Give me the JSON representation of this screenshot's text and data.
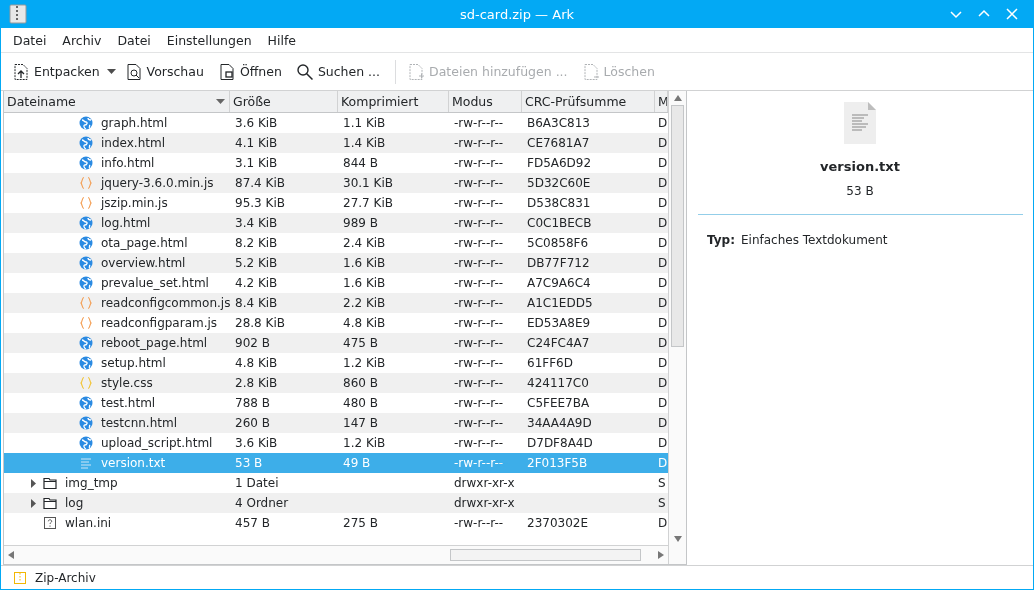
{
  "window": {
    "title": "sd-card.zip — Ark"
  },
  "menu": [
    "Datei",
    "Archiv",
    "Datei",
    "Einstellungen",
    "Hilfe"
  ],
  "toolbar": [
    {
      "label": "Entpacken",
      "kind": "extract",
      "disabled": false,
      "has_menu": true
    },
    {
      "label": "Vorschau",
      "kind": "preview",
      "disabled": false,
      "has_menu": false
    },
    {
      "label": "Öffnen",
      "kind": "open",
      "disabled": false,
      "has_menu": false
    },
    {
      "label": "Suchen ...",
      "kind": "search",
      "disabled": false,
      "has_menu": false
    },
    {
      "label": "Dateien hinzufügen ...",
      "kind": "add",
      "disabled": true,
      "has_menu": false
    },
    {
      "label": "Löschen",
      "kind": "delete",
      "disabled": true,
      "has_menu": false
    }
  ],
  "table": {
    "columns": [
      {
        "label": "Dateiname",
        "sorted": true
      },
      {
        "label": "Größe",
        "sorted": false
      },
      {
        "label": "Komprimiert",
        "sorted": false
      },
      {
        "label": "Modus",
        "sorted": false
      },
      {
        "label": "CRC-Prüfsumme",
        "sorted": false
      },
      {
        "label": "M"
      }
    ],
    "open_folder_children": [
      {
        "name": "graph.html",
        "size": "3.6 KiB",
        "compressed": "1.1 KiB",
        "mode": "-rw-r--r--",
        "crc": "B6A3C813",
        "column_6": "D",
        "kind": "web",
        "selected": false
      },
      {
        "name": "index.html",
        "size": "4.1 KiB",
        "compressed": "1.4 KiB",
        "mode": "-rw-r--r--",
        "crc": "CE7681A7",
        "column_6": "D",
        "kind": "web",
        "selected": false
      },
      {
        "name": "info.html",
        "size": "3.1 KiB",
        "compressed": "844 B",
        "mode": "-rw-r--r--",
        "crc": "FD5A6D92",
        "column_6": "D",
        "kind": "web",
        "selected": false
      },
      {
        "name": "jquery-3.6.0.min.js",
        "size": "87.4 KiB",
        "compressed": "30.1 KiB",
        "mode": "-rw-r--r--",
        "crc": "5D32C60E",
        "column_6": "D",
        "kind": "script",
        "selected": false
      },
      {
        "name": "jszip.min.js",
        "size": "95.3 KiB",
        "compressed": "27.7 KiB",
        "mode": "-rw-r--r--",
        "crc": "D538C831",
        "column_6": "D",
        "kind": "script",
        "selected": false
      },
      {
        "name": "log.html",
        "size": "3.4 KiB",
        "compressed": "989 B",
        "mode": "-rw-r--r--",
        "crc": "C0C1BECB",
        "column_6": "D",
        "kind": "web",
        "selected": false
      },
      {
        "name": "ota_page.html",
        "size": "8.2 KiB",
        "compressed": "2.4 KiB",
        "mode": "-rw-r--r--",
        "crc": "5C0858F6",
        "column_6": "D",
        "kind": "web",
        "selected": false
      },
      {
        "name": "overview.html",
        "size": "5.2 KiB",
        "compressed": "1.6 KiB",
        "mode": "-rw-r--r--",
        "crc": "DB77F712",
        "column_6": "D",
        "kind": "web",
        "selected": false
      },
      {
        "name": "prevalue_set.html",
        "size": "4.2 KiB",
        "compressed": "1.6 KiB",
        "mode": "-rw-r--r--",
        "crc": "A7C9A6C4",
        "column_6": "D",
        "kind": "web",
        "selected": false
      },
      {
        "name": "readconfigcommon.js",
        "size": "8.4 KiB",
        "compressed": "2.2 KiB",
        "mode": "-rw-r--r--",
        "crc": "A1C1EDD5",
        "column_6": "D",
        "kind": "script",
        "selected": false
      },
      {
        "name": "readconfigparam.js",
        "size": "28.8 KiB",
        "compressed": "4.8 KiB",
        "mode": "-rw-r--r--",
        "crc": "ED53A8E9",
        "column_6": "D",
        "kind": "script",
        "selected": false
      },
      {
        "name": "reboot_page.html",
        "size": "902 B",
        "compressed": "475 B",
        "mode": "-rw-r--r--",
        "crc": "C24FC4A7",
        "column_6": "D",
        "kind": "web",
        "selected": false
      },
      {
        "name": "setup.html",
        "size": "4.8 KiB",
        "compressed": "1.2 KiB",
        "mode": "-rw-r--r--",
        "crc": "61FF6D",
        "column_6": "D",
        "kind": "web",
        "selected": false
      },
      {
        "name": "style.css",
        "size": "2.8 KiB",
        "compressed": "860 B",
        "mode": "-rw-r--r--",
        "crc": "424117C0",
        "column_6": "D",
        "kind": "css",
        "selected": false
      },
      {
        "name": "test.html",
        "size": "788 B",
        "compressed": "480 B",
        "mode": "-rw-r--r--",
        "crc": "C5FEE7BA",
        "column_6": "D",
        "kind": "web",
        "selected": false
      },
      {
        "name": "testcnn.html",
        "size": "260 B",
        "compressed": "147 B",
        "mode": "-rw-r--r--",
        "crc": "34AA4A9D",
        "column_6": "D",
        "kind": "web",
        "selected": false
      },
      {
        "name": "upload_script.html",
        "size": "3.6 KiB",
        "compressed": "1.2 KiB",
        "mode": "-rw-r--r--",
        "crc": "D7DF8A4D",
        "column_6": "D",
        "kind": "web",
        "selected": false
      },
      {
        "name": "version.txt",
        "size": "53 B",
        "compressed": "49 B",
        "mode": "-rw-r--r--",
        "crc": "2F013F5B",
        "column_6": "D",
        "kind": "text",
        "selected": true
      }
    ],
    "rows": [
      {
        "name": "img_tmp",
        "size": "1 Datei",
        "mode": "drwxr-xr-x",
        "column_6": "S",
        "kind": "folder",
        "expanded": false,
        "selected": false
      },
      {
        "name": "log",
        "size": "4 Ordner",
        "mode": "drwxr-xr-x",
        "column_6": "S",
        "kind": "folder",
        "expanded": false,
        "selected": false
      },
      {
        "name": "wlan.ini",
        "size": "457 B",
        "compressed": "275 B",
        "mode": "-rw-r--r--",
        "crc": "2370302E",
        "column_6": "D",
        "kind": "ini",
        "selected": false
      }
    ]
  },
  "details": {
    "name": "version.txt",
    "size": "53 B",
    "type_label": "Typ:",
    "type_value": "Einfaches Textdokument"
  },
  "status_bar": {
    "text": "Zip-Archiv"
  }
}
